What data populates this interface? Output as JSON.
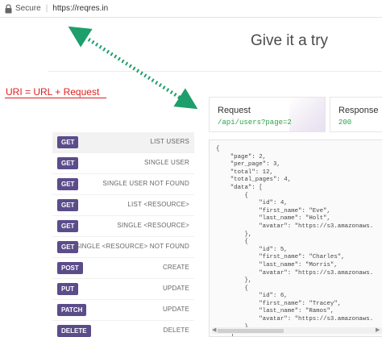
{
  "browser": {
    "secure_label": "Secure",
    "separator": "|",
    "url": "https://reqres.in"
  },
  "page": {
    "title": "Give it a try"
  },
  "annotation": {
    "label": "URI = URL + Request",
    "arrow_color": "#1e9e6a",
    "label_color": "#e02020"
  },
  "request": {
    "heading": "Request",
    "value": "/api/users?page=2"
  },
  "response": {
    "heading": "Response",
    "value": "200"
  },
  "colors": {
    "badge": "#5b4c8a",
    "green": "#2fa04a"
  },
  "endpoints": [
    {
      "method": "GET",
      "label": "LIST USERS"
    },
    {
      "method": "GET",
      "label": "SINGLE USER"
    },
    {
      "method": "GET",
      "label": "SINGLE USER NOT FOUND"
    },
    {
      "method": "GET",
      "label": "LIST <RESOURCE>"
    },
    {
      "method": "GET",
      "label": "SINGLE <RESOURCE>"
    },
    {
      "method": "GET",
      "label": "SINGLE <RESOURCE> NOT FOUND"
    },
    {
      "method": "POST",
      "label": "CREATE"
    },
    {
      "method": "PUT",
      "label": "UPDATE"
    },
    {
      "method": "PATCH",
      "label": "UPDATE"
    },
    {
      "method": "DELETE",
      "label": "DELETE"
    }
  ],
  "response_body": "{\n    \"page\": 2,\n    \"per_page\": 3,\n    \"total\": 12,\n    \"total_pages\": 4,\n    \"data\": [\n        {\n            \"id\": 4,\n            \"first_name\": \"Eve\",\n            \"last_name\": \"Holt\",\n            \"avatar\": \"https://s3.amazonaws.\n        },\n        {\n            \"id\": 5,\n            \"first_name\": \"Charles\",\n            \"last_name\": \"Morris\",\n            \"avatar\": \"https://s3.amazonaws.\n        },\n        {\n            \"id\": 6,\n            \"first_name\": \"Tracey\",\n            \"last_name\": \"Ramos\",\n            \"avatar\": \"https://s3.amazonaws.\n        }\n    ]\n}"
}
